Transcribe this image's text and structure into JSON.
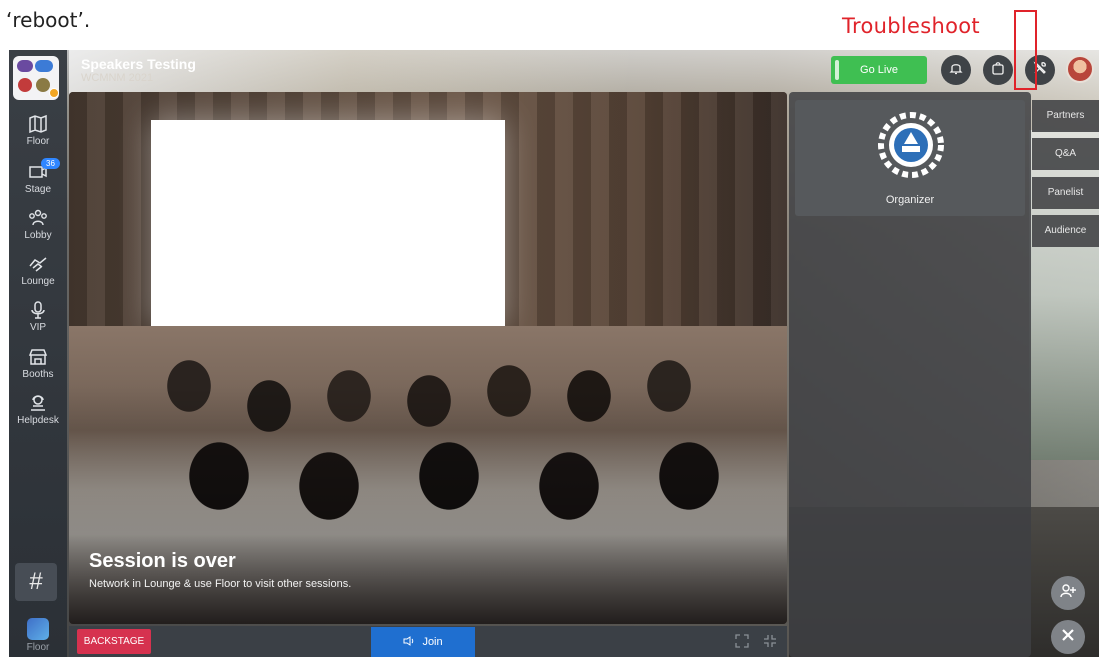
{
  "annotation": {
    "doc_text": "‘reboot’.",
    "troubleshoot_label": "Troubleshoot",
    "highlight_color": "#e0232a"
  },
  "header": {
    "title": "Speakers Testing",
    "subtitle": "WCMNM 2021",
    "go_live_label": "Go Live"
  },
  "sidebar": {
    "items": [
      {
        "label": "Floor",
        "icon": "map-icon"
      },
      {
        "label": "Stage",
        "icon": "stage-icon",
        "badge": "36"
      },
      {
        "label": "Lobby",
        "icon": "people-icon"
      },
      {
        "label": "Lounge",
        "icon": "handshake-icon"
      },
      {
        "label": "VIP",
        "icon": "microphone-icon"
      },
      {
        "label": "Booths",
        "icon": "booth-icon"
      },
      {
        "label": "Helpdesk",
        "icon": "helpdesk-icon"
      }
    ],
    "hash_label": "#",
    "bottom_label": "Floor"
  },
  "video": {
    "session_title": "Session is over",
    "session_subtitle": "Network in Lounge & use Floor to visit other sessions."
  },
  "bottombar": {
    "backstage_label": "BACKSTAGE",
    "join_label": "Join"
  },
  "panel": {
    "organizer_label": "Organizer"
  },
  "right_tabs": [
    "Partners",
    "Q&A",
    "Panelist",
    "Audience"
  ],
  "colors": {
    "go_live": "#3fbf52",
    "backstage": "#d6324f",
    "join": "#1f6fd0",
    "badge": "#2f86ff"
  }
}
